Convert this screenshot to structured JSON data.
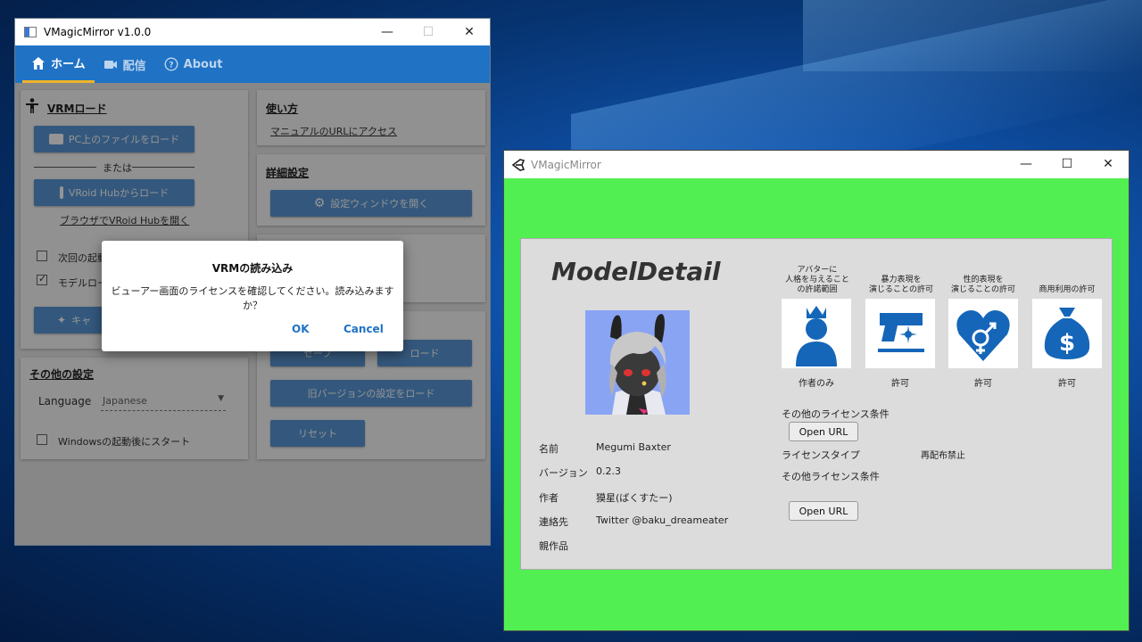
{
  "main_window": {
    "title": "VMagicMirror v1.0.0",
    "controls": {
      "minimize": "—",
      "maximize": "☐",
      "close": "✕"
    },
    "tabs": [
      {
        "label": "ホーム",
        "icon": "home-icon",
        "active": true
      },
      {
        "label": "配信",
        "icon": "video-camera-icon",
        "active": false
      },
      {
        "label": "About",
        "icon": "help-circle-icon",
        "active": false
      }
    ],
    "vrm_load": {
      "title": "VRMロード",
      "load_file_button": "PC上のファイルをロード",
      "or_label": "または",
      "vroid_hub_button": "VRoid Hubからロード",
      "browser_link": "ブラウザでVRoid Hubを開く",
      "check_next_start": "次回の起動",
      "check_model_load": "モデルロー",
      "calib_button": "キャ"
    },
    "usage": {
      "title": "使い方",
      "manual_link": "マニュアルのURLにアクセス"
    },
    "detail_settings": {
      "title": "詳細設定",
      "open_settings_button": "設定ウィンドウを開く"
    },
    "save_load": {
      "save_button": "セーブ",
      "load_button": "ロード",
      "old_version_button": "旧バージョンの設定をロード",
      "reset_button": "リセット"
    },
    "other_settings": {
      "title": "その他の設定",
      "language_label": "Language",
      "language_value": "Japanese",
      "startup_label": "Windowsの起動後にスタート"
    }
  },
  "dialog": {
    "title": "VRMの読み込み",
    "message": "ビューアー画面のライセンスを確認してください。読み込みますか？",
    "ok_label": "OK",
    "cancel_label": "Cancel"
  },
  "vm_window": {
    "title": "VMagicMirror",
    "controls": {
      "minimize": "—",
      "maximize": "☐",
      "close": "✕"
    },
    "detail_title": "ModelDetail",
    "info": [
      {
        "label": "名前",
        "value": "Megumi Baxter"
      },
      {
        "label": "バージョン",
        "value": "0.2.3"
      },
      {
        "label": "作者",
        "value": "獏星(ばくすたー)"
      },
      {
        "label": "連絡先",
        "value": "Twitter @baku_dreameater"
      },
      {
        "label": "親作品",
        "value": ""
      }
    ],
    "permissions": [
      {
        "heading": "アバターに\n人格を与えること\nの許諾範囲",
        "icon": "person-crown-icon",
        "value": "作者のみ"
      },
      {
        "heading": "暴力表現を\n演じることの許可",
        "icon": "gun-icon",
        "value": "許可"
      },
      {
        "heading": "性的表現を\n演じることの許可",
        "icon": "heart-gender-icon",
        "value": "許可"
      },
      {
        "heading": "商用利用の許可",
        "icon": "money-bag-icon",
        "value": "許可"
      }
    ],
    "other_license_label": "その他のライセンス条件",
    "open_url_label": "Open URL",
    "license_type_label": "ライセンスタイプ",
    "license_type_value": "再配布禁止",
    "other_license_label_2": "その他ライセンス条件",
    "open_url_label_2": "Open URL"
  },
  "colors": {
    "accent_blue": "#1f72c4",
    "green_screen": "#52ef52",
    "icon_blue": "#1566b8",
    "tab_underline": "#f0b429"
  }
}
